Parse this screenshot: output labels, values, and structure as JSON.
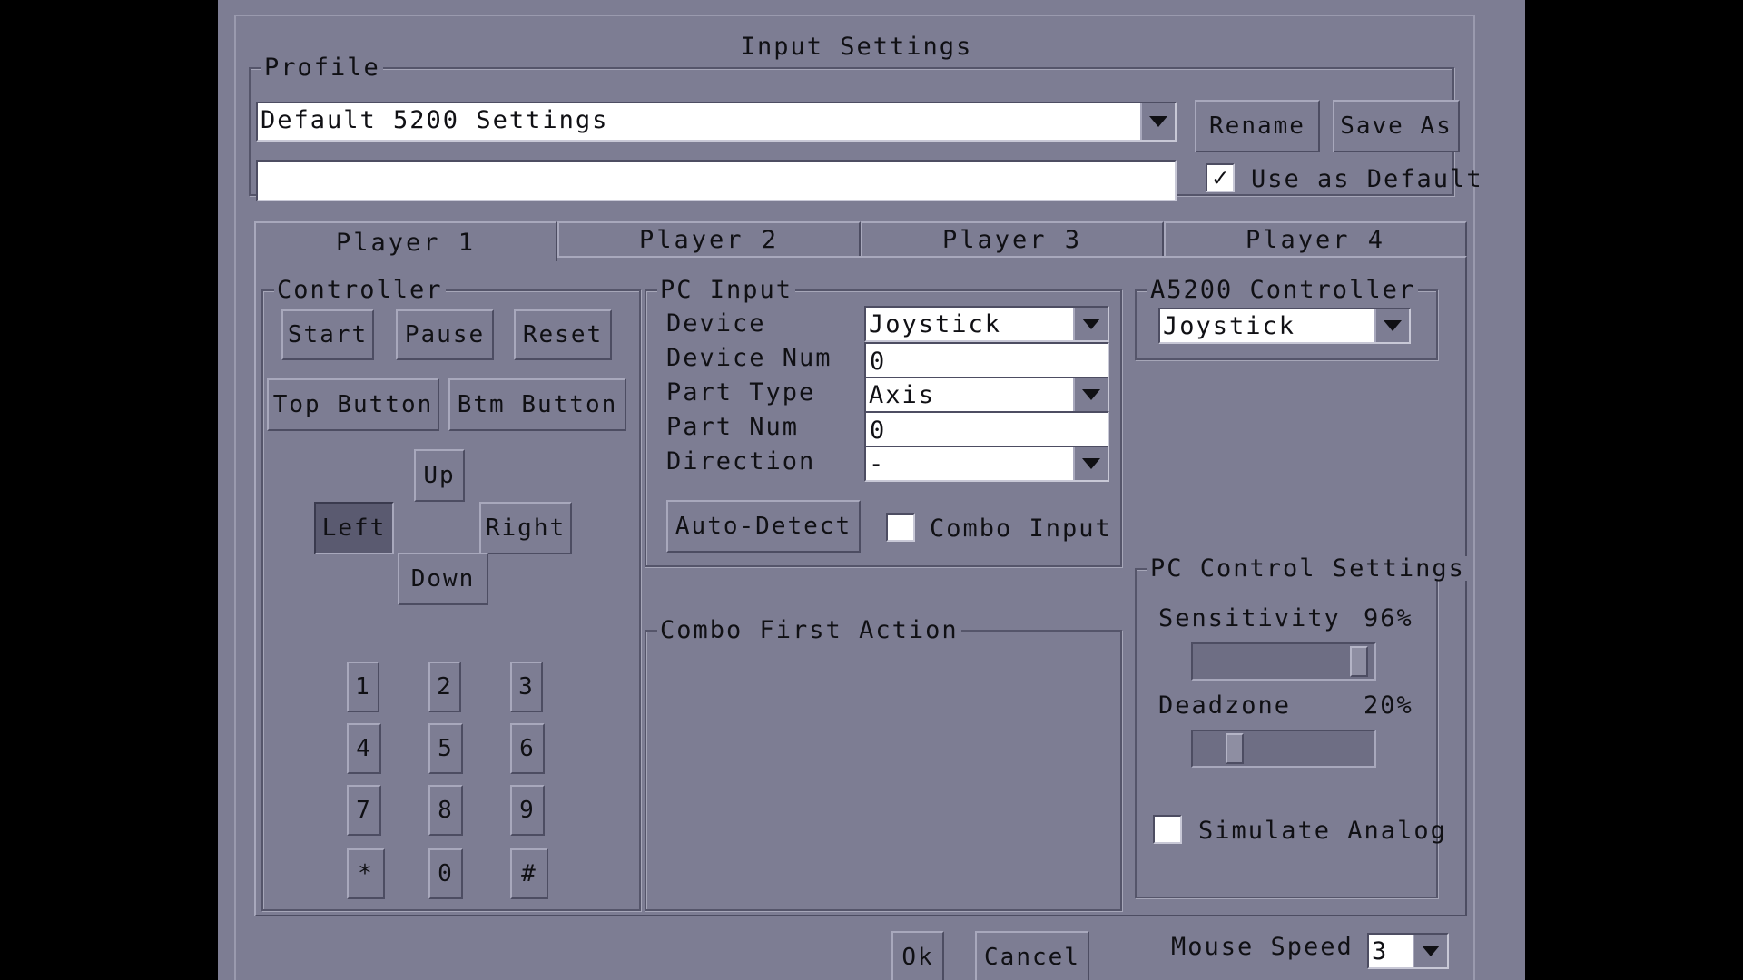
{
  "dialog": {
    "title": "Input Settings"
  },
  "profile": {
    "legend": "Profile",
    "selected": "Default 5200 Settings",
    "description": "",
    "rename_label": "Rename",
    "save_as_label": "Save As",
    "use_default_label": "Use as Default",
    "use_default_checked": true
  },
  "tabs": [
    {
      "label": "Player 1",
      "active": true
    },
    {
      "label": "Player 2",
      "active": false
    },
    {
      "label": "Player 3",
      "active": false
    },
    {
      "label": "Player 4",
      "active": false
    }
  ],
  "controller": {
    "legend": "Controller",
    "start": "Start",
    "pause": "Pause",
    "reset": "Reset",
    "top_button": "Top Button",
    "btm_button": "Btm Button",
    "up": "Up",
    "left": "Left",
    "right": "Right",
    "down": "Down",
    "keypad": [
      "1",
      "2",
      "3",
      "4",
      "5",
      "6",
      "7",
      "8",
      "9",
      "*",
      "0",
      "#"
    ],
    "selected": "Left"
  },
  "pc_input": {
    "legend": "PC Input",
    "device_label": "Device",
    "device_value": "Joystick",
    "device_num_label": "Device Num",
    "device_num_value": "0",
    "part_type_label": "Part Type",
    "part_type_value": "Axis",
    "part_num_label": "Part Num",
    "part_num_value": "0",
    "direction_label": "Direction",
    "direction_value": "-",
    "auto_detect_label": "Auto-Detect",
    "combo_input_label": "Combo Input",
    "combo_input_checked": false
  },
  "combo_first_action": {
    "legend": "Combo First Action"
  },
  "a5200": {
    "legend": "A5200 Controller",
    "value": "Joystick"
  },
  "pc_control": {
    "legend": "PC Control Settings",
    "sensitivity_label": "Sensitivity",
    "sensitivity_value": "96%",
    "sensitivity_level": 0.96,
    "deadzone_label": "Deadzone",
    "deadzone_value": "20%",
    "deadzone_level": 0.2,
    "simulate_analog_label": "Simulate Analog",
    "simulate_analog_checked": false
  },
  "footer": {
    "ok_label": "Ok",
    "cancel_label": "Cancel",
    "mouse_speed_label": "Mouse Speed",
    "mouse_speed_value": "3"
  },
  "colors": {
    "background": "#7d7d93",
    "screen_border": "#000000"
  }
}
